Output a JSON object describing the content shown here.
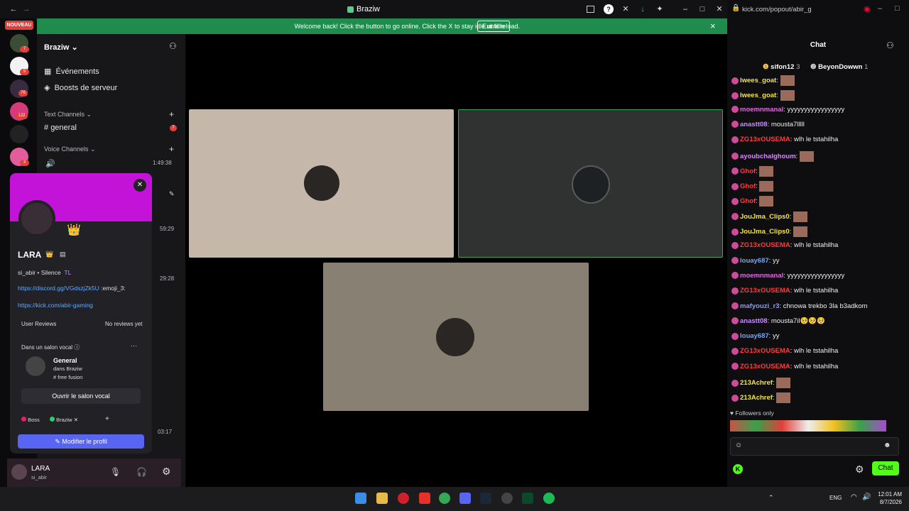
{
  "window": {
    "title": "Braziw",
    "back_glyph": "←",
    "forward_glyph": "→"
  },
  "banner": {
    "text": "Welcome back! Click the button to go online. Click the X to stay idle until reload.",
    "button": "Exit Idle",
    "close": "×"
  },
  "rail": {
    "new_label": "NOUVEAU",
    "badges": [
      "7",
      "9",
      "76",
      "122",
      "3"
    ]
  },
  "server": {
    "name": "Braziw",
    "items": [
      {
        "label": "Événements"
      },
      {
        "label": "Boosts de serveur"
      }
    ],
    "text_category": "Text Channels",
    "text_channels": [
      {
        "name": "general",
        "badge": "7"
      }
    ],
    "voice_category": "Voice Channels",
    "voice_timer": "1:49:38",
    "side_timers": [
      "59:29",
      "29:28"
    ],
    "call_timer": "03:17"
  },
  "profile": {
    "name": "LARA",
    "username": "si_abir",
    "status": "Silence",
    "tag": "TL",
    "links": [
      "https://discord.gg/VGdszjZk5U",
      "https://kick.com/abir-gaming"
    ],
    "emoji_text": ":emoji_3:",
    "reviews_label": "User Reviews",
    "reviews_value": "No reviews yet",
    "voice_label": "Dans un salon vocal",
    "voice_channel": "General",
    "voice_server": "dans Braziw",
    "voice_sub": "# free fusion",
    "open_voice": "Ouvrir le salon vocal",
    "roles": [
      {
        "name": "Boss",
        "color": "#e91e63"
      },
      {
        "name": "Braziw",
        "color": "#2ecc71"
      }
    ],
    "edit_button": "Modifier le profil"
  },
  "user_panel": {
    "name": "LARA",
    "username": "si_abir"
  },
  "browser": {
    "url": "kick.com/popout/abir_g"
  },
  "chat": {
    "title": "Chat",
    "leaders": [
      {
        "name": "sifon12",
        "count": "3"
      },
      {
        "name": "BeyonDowwn",
        "count": "1"
      }
    ],
    "messages": [
      {
        "user": "lwees_goat",
        "color": "#f5e642",
        "text": "",
        "emote": true
      },
      {
        "user": "lwees_goat",
        "color": "#f5e642",
        "text": "",
        "emote": true
      },
      {
        "user": "moemnmanal",
        "color": "#e06be0",
        "text": "yyyyyyyyyyyyyyyyy"
      },
      {
        "user": "anastt08",
        "color": "#c98bff",
        "text": "mousta7lllll"
      },
      {
        "user": "ZG13xOUSEMA",
        "color": "#ff3b3b",
        "text": "wlh le tstahilha"
      },
      {
        "user": "ayoubchalghoum",
        "color": "#d889ff",
        "text": "",
        "emote": true
      },
      {
        "user": "Ghof",
        "color": "#ff3b3b",
        "text": "",
        "emote": true
      },
      {
        "user": "Ghof",
        "color": "#ff3b3b",
        "text": "",
        "emote": true
      },
      {
        "user": "Ghof",
        "color": "#ff3b3b",
        "text": "",
        "emote": true
      },
      {
        "user": "JouJma_Clips0",
        "color": "#f5e642",
        "text": "",
        "emote": true
      },
      {
        "user": "JouJma_Clips0",
        "color": "#f5e642",
        "text": "",
        "emote": true
      },
      {
        "user": "ZG13xOUSEMA",
        "color": "#ff3b3b",
        "text": "wlh le tstahilha"
      },
      {
        "user": "louay687",
        "color": "#6fa8ff",
        "text": "yy"
      },
      {
        "user": "moemnmanal",
        "color": "#e06be0",
        "text": "yyyyyyyyyyyyyyyyy"
      },
      {
        "user": "ZG13xOUSEMA",
        "color": "#ff3b3b",
        "text": "wlh le tstahilha"
      },
      {
        "user": "mafyouzi_r3",
        "color": "#8b9cff",
        "text": "chnowa trekbo 3la b3adkom"
      },
      {
        "user": "anastt08",
        "color": "#c98bff",
        "text": "mousta7il🥺🥺🥺"
      },
      {
        "user": "louay687",
        "color": "#6fa8ff",
        "text": "yy"
      },
      {
        "user": "ZG13xOUSEMA",
        "color": "#ff3b3b",
        "text": "wlh le tstahilha"
      },
      {
        "user": "ZG13xOUSEMA",
        "color": "#ff3b3b",
        "text": "wlh le tstahilha"
      },
      {
        "user": "213Achref",
        "color": "#f5e642",
        "text": "",
        "emote": true
      },
      {
        "user": "213Achref",
        "color": "#f5e642",
        "text": "",
        "emote": true
      }
    ],
    "followers_only": "Followers only",
    "send_button": "Chat"
  },
  "taskbar": {
    "lang": "ENG",
    "time": "12:01 AM",
    "date": "8/7/2026"
  }
}
